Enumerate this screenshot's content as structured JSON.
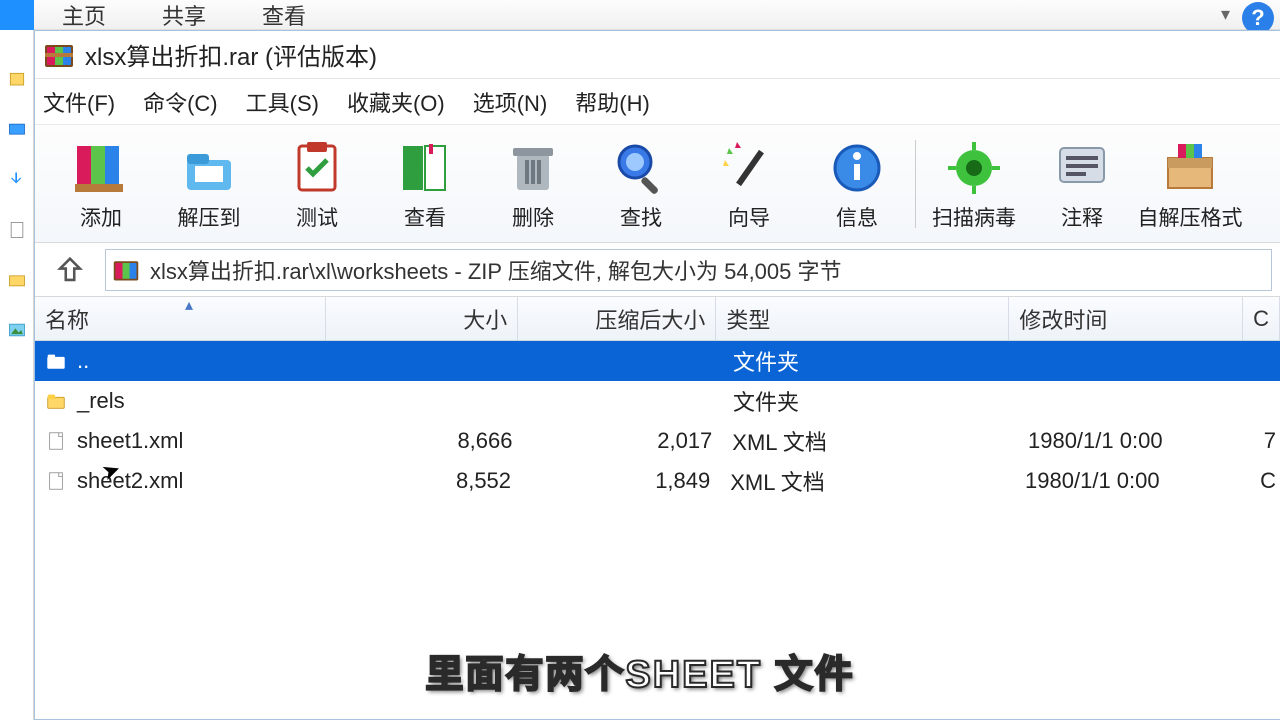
{
  "outer_tabs": {
    "t1": "主页",
    "t2": "共享",
    "t3": "查看"
  },
  "title": "xlsx算出折扣.rar (评估版本)",
  "menu": {
    "file": "文件(F)",
    "cmd": "命令(C)",
    "tools": "工具(S)",
    "fav": "收藏夹(O)",
    "opt": "选项(N)",
    "help": "帮助(H)"
  },
  "toolbar": {
    "add": "添加",
    "extract": "解压到",
    "test": "测试",
    "view": "查看",
    "delete": "删除",
    "find": "查找",
    "wizard": "向导",
    "info": "信息",
    "virus": "扫描病毒",
    "comment": "注释",
    "sfx": "自解压格式"
  },
  "path": "xlsx算出折扣.rar\\xl\\worksheets - ZIP 压缩文件, 解包大小为 54,005 字节",
  "headers": {
    "name": "名称",
    "size": "大小",
    "packed": "压缩后大小",
    "type": "类型",
    "modified": "修改时间",
    "crc": "C"
  },
  "rows": [
    {
      "name": "..",
      "size": "",
      "packed": "",
      "type": "文件夹",
      "modified": "",
      "crc": "",
      "icon": "updir",
      "selected": true
    },
    {
      "name": "_rels",
      "size": "",
      "packed": "",
      "type": "文件夹",
      "modified": "",
      "crc": "",
      "icon": "folder",
      "selected": false
    },
    {
      "name": "sheet1.xml",
      "size": "8,666",
      "packed": "2,017",
      "type": "XML 文档",
      "modified": "1980/1/1 0:00",
      "crc": "7",
      "icon": "file",
      "selected": false
    },
    {
      "name": "sheet2.xml",
      "size": "8,552",
      "packed": "1,849",
      "type": "XML 文档",
      "modified": "1980/1/1 0:00",
      "crc": "C",
      "icon": "file",
      "selected": false
    }
  ],
  "subtitle": "里面有两个SHEET 文件",
  "help_badge": "?"
}
